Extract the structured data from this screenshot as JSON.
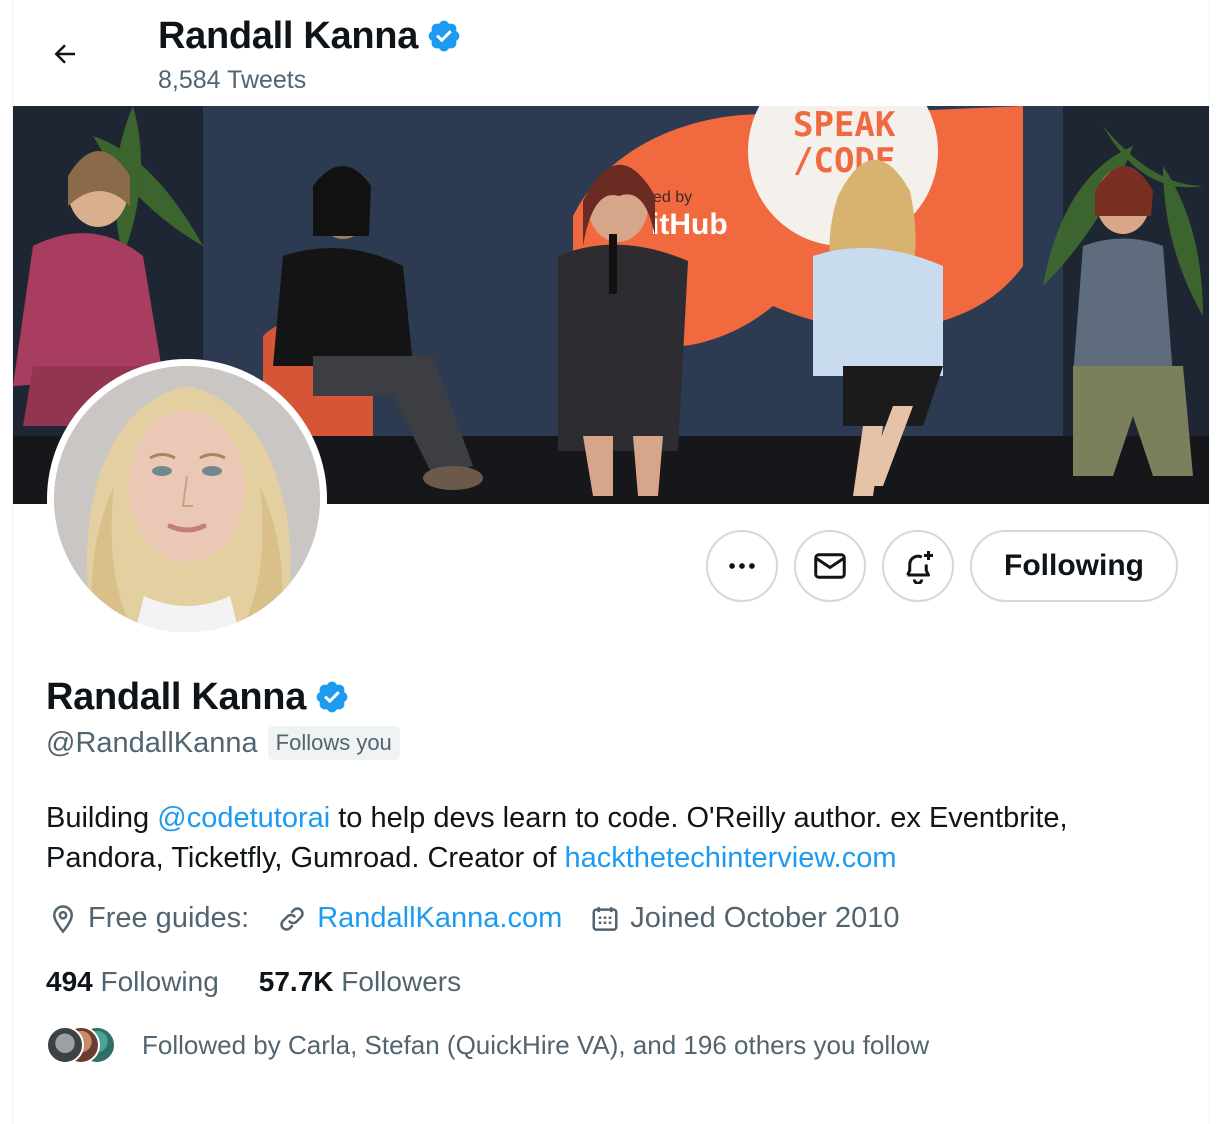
{
  "header": {
    "name": "Randall Kanna",
    "tweet_count": "8,584 Tweets"
  },
  "banner": {
    "sign_text_1": "SPEAK",
    "sign_text_2": "/CODE",
    "sponsor_text_1": "ed by",
    "sponsor_text_2": "itHub"
  },
  "actions": {
    "follow_label": "Following"
  },
  "profile": {
    "name": "Randall Kanna",
    "handle": "@RandallKanna",
    "follows_you": "Follows you",
    "bio_1": "Building ",
    "bio_mention": "@codetutorai",
    "bio_2": " to help devs learn to code. O'Reilly author. ex Eventbrite, Pandora, Ticketfly, Gumroad. Creator of ",
    "bio_link": "hackthetechinterview.com",
    "location": "Free guides:",
    "website": "RandallKanna.com",
    "joined": "Joined October 2010"
  },
  "stats": {
    "following_count": "494",
    "following_label": "Following",
    "followers_count": "57.7K",
    "followers_label": "Followers"
  },
  "followed_by": "Followed by Carla, Stefan (QuickHire VA), and 196 others you follow",
  "colors": {
    "accent": "#1d9bf0",
    "text_primary": "#0f1419",
    "text_secondary": "#536471",
    "border": "#cfd9de"
  }
}
